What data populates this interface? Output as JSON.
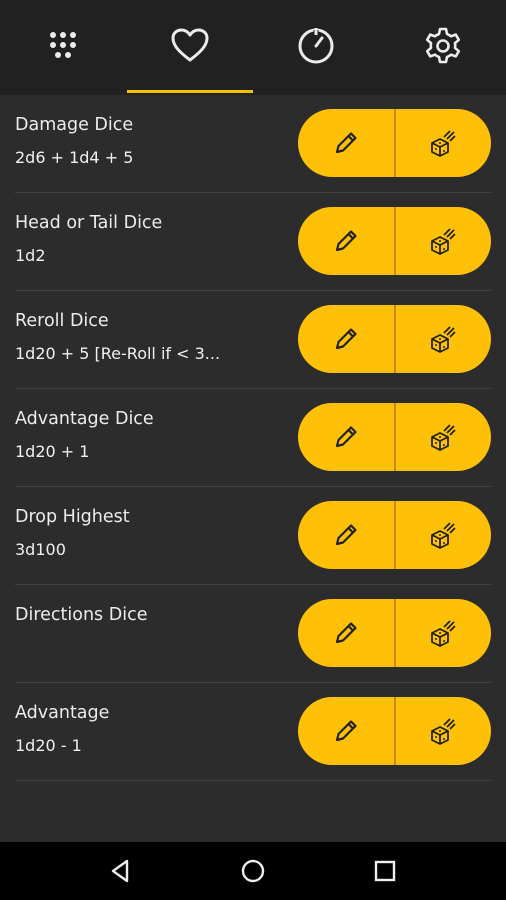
{
  "colors": {
    "accent": "#ffc107",
    "background": "#2c2c2c",
    "toolbar": "#212121"
  },
  "tabs": [
    {
      "icon": "dice-grid-icon",
      "selected": false
    },
    {
      "icon": "heart-icon",
      "selected": true
    },
    {
      "icon": "timer-icon",
      "selected": false
    },
    {
      "icon": "gear-icon",
      "selected": false
    }
  ],
  "dice": [
    {
      "name": "Damage Dice",
      "formula": "2d6  + 1d4  + 5"
    },
    {
      "name": "Head or Tail Dice",
      "formula": "1d2"
    },
    {
      "name": "Reroll Dice",
      "formula": "1d20  + 5 [Re-Roll if < 3..."
    },
    {
      "name": "Advantage Dice",
      "formula": "1d20  + 1"
    },
    {
      "name": "Drop Highest",
      "formula": "3d100"
    },
    {
      "name": "Directions Dice",
      "formula": ""
    },
    {
      "name": "Advantage",
      "formula": "1d20  - 1"
    }
  ],
  "row_actions": {
    "edit_icon": "pencil-icon",
    "roll_icon": "dice-roll-icon"
  },
  "nav": [
    "back-icon",
    "home-icon",
    "recents-icon"
  ]
}
